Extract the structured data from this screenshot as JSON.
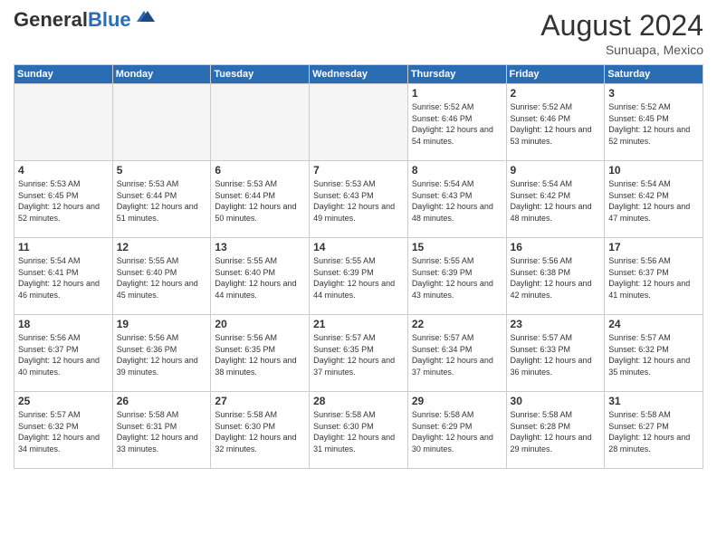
{
  "header": {
    "logo_general": "General",
    "logo_blue": "Blue",
    "month_title": "August 2024",
    "location": "Sunuapa, Mexico"
  },
  "days_of_week": [
    "Sunday",
    "Monday",
    "Tuesday",
    "Wednesday",
    "Thursday",
    "Friday",
    "Saturday"
  ],
  "weeks": [
    [
      {
        "day": "",
        "empty": true
      },
      {
        "day": "",
        "empty": true
      },
      {
        "day": "",
        "empty": true
      },
      {
        "day": "",
        "empty": true
      },
      {
        "day": "1",
        "sunrise": "5:52 AM",
        "sunset": "6:46 PM",
        "daylight": "12 hours and 54 minutes."
      },
      {
        "day": "2",
        "sunrise": "5:52 AM",
        "sunset": "6:46 PM",
        "daylight": "12 hours and 53 minutes."
      },
      {
        "day": "3",
        "sunrise": "5:52 AM",
        "sunset": "6:45 PM",
        "daylight": "12 hours and 52 minutes."
      }
    ],
    [
      {
        "day": "4",
        "sunrise": "5:53 AM",
        "sunset": "6:45 PM",
        "daylight": "12 hours and 52 minutes."
      },
      {
        "day": "5",
        "sunrise": "5:53 AM",
        "sunset": "6:44 PM",
        "daylight": "12 hours and 51 minutes."
      },
      {
        "day": "6",
        "sunrise": "5:53 AM",
        "sunset": "6:44 PM",
        "daylight": "12 hours and 50 minutes."
      },
      {
        "day": "7",
        "sunrise": "5:53 AM",
        "sunset": "6:43 PM",
        "daylight": "12 hours and 49 minutes."
      },
      {
        "day": "8",
        "sunrise": "5:54 AM",
        "sunset": "6:43 PM",
        "daylight": "12 hours and 48 minutes."
      },
      {
        "day": "9",
        "sunrise": "5:54 AM",
        "sunset": "6:42 PM",
        "daylight": "12 hours and 48 minutes."
      },
      {
        "day": "10",
        "sunrise": "5:54 AM",
        "sunset": "6:42 PM",
        "daylight": "12 hours and 47 minutes."
      }
    ],
    [
      {
        "day": "11",
        "sunrise": "5:54 AM",
        "sunset": "6:41 PM",
        "daylight": "12 hours and 46 minutes."
      },
      {
        "day": "12",
        "sunrise": "5:55 AM",
        "sunset": "6:40 PM",
        "daylight": "12 hours and 45 minutes."
      },
      {
        "day": "13",
        "sunrise": "5:55 AM",
        "sunset": "6:40 PM",
        "daylight": "12 hours and 44 minutes."
      },
      {
        "day": "14",
        "sunrise": "5:55 AM",
        "sunset": "6:39 PM",
        "daylight": "12 hours and 44 minutes."
      },
      {
        "day": "15",
        "sunrise": "5:55 AM",
        "sunset": "6:39 PM",
        "daylight": "12 hours and 43 minutes."
      },
      {
        "day": "16",
        "sunrise": "5:56 AM",
        "sunset": "6:38 PM",
        "daylight": "12 hours and 42 minutes."
      },
      {
        "day": "17",
        "sunrise": "5:56 AM",
        "sunset": "6:37 PM",
        "daylight": "12 hours and 41 minutes."
      }
    ],
    [
      {
        "day": "18",
        "sunrise": "5:56 AM",
        "sunset": "6:37 PM",
        "daylight": "12 hours and 40 minutes."
      },
      {
        "day": "19",
        "sunrise": "5:56 AM",
        "sunset": "6:36 PM",
        "daylight": "12 hours and 39 minutes."
      },
      {
        "day": "20",
        "sunrise": "5:56 AM",
        "sunset": "6:35 PM",
        "daylight": "12 hours and 38 minutes."
      },
      {
        "day": "21",
        "sunrise": "5:57 AM",
        "sunset": "6:35 PM",
        "daylight": "12 hours and 37 minutes."
      },
      {
        "day": "22",
        "sunrise": "5:57 AM",
        "sunset": "6:34 PM",
        "daylight": "12 hours and 37 minutes."
      },
      {
        "day": "23",
        "sunrise": "5:57 AM",
        "sunset": "6:33 PM",
        "daylight": "12 hours and 36 minutes."
      },
      {
        "day": "24",
        "sunrise": "5:57 AM",
        "sunset": "6:32 PM",
        "daylight": "12 hours and 35 minutes."
      }
    ],
    [
      {
        "day": "25",
        "sunrise": "5:57 AM",
        "sunset": "6:32 PM",
        "daylight": "12 hours and 34 minutes."
      },
      {
        "day": "26",
        "sunrise": "5:58 AM",
        "sunset": "6:31 PM",
        "daylight": "12 hours and 33 minutes."
      },
      {
        "day": "27",
        "sunrise": "5:58 AM",
        "sunset": "6:30 PM",
        "daylight": "12 hours and 32 minutes."
      },
      {
        "day": "28",
        "sunrise": "5:58 AM",
        "sunset": "6:30 PM",
        "daylight": "12 hours and 31 minutes."
      },
      {
        "day": "29",
        "sunrise": "5:58 AM",
        "sunset": "6:29 PM",
        "daylight": "12 hours and 30 minutes."
      },
      {
        "day": "30",
        "sunrise": "5:58 AM",
        "sunset": "6:28 PM",
        "daylight": "12 hours and 29 minutes."
      },
      {
        "day": "31",
        "sunrise": "5:58 AM",
        "sunset": "6:27 PM",
        "daylight": "12 hours and 28 minutes."
      }
    ]
  ],
  "labels": {
    "sunrise": "Sunrise:",
    "sunset": "Sunset:",
    "daylight": "Daylight:"
  }
}
